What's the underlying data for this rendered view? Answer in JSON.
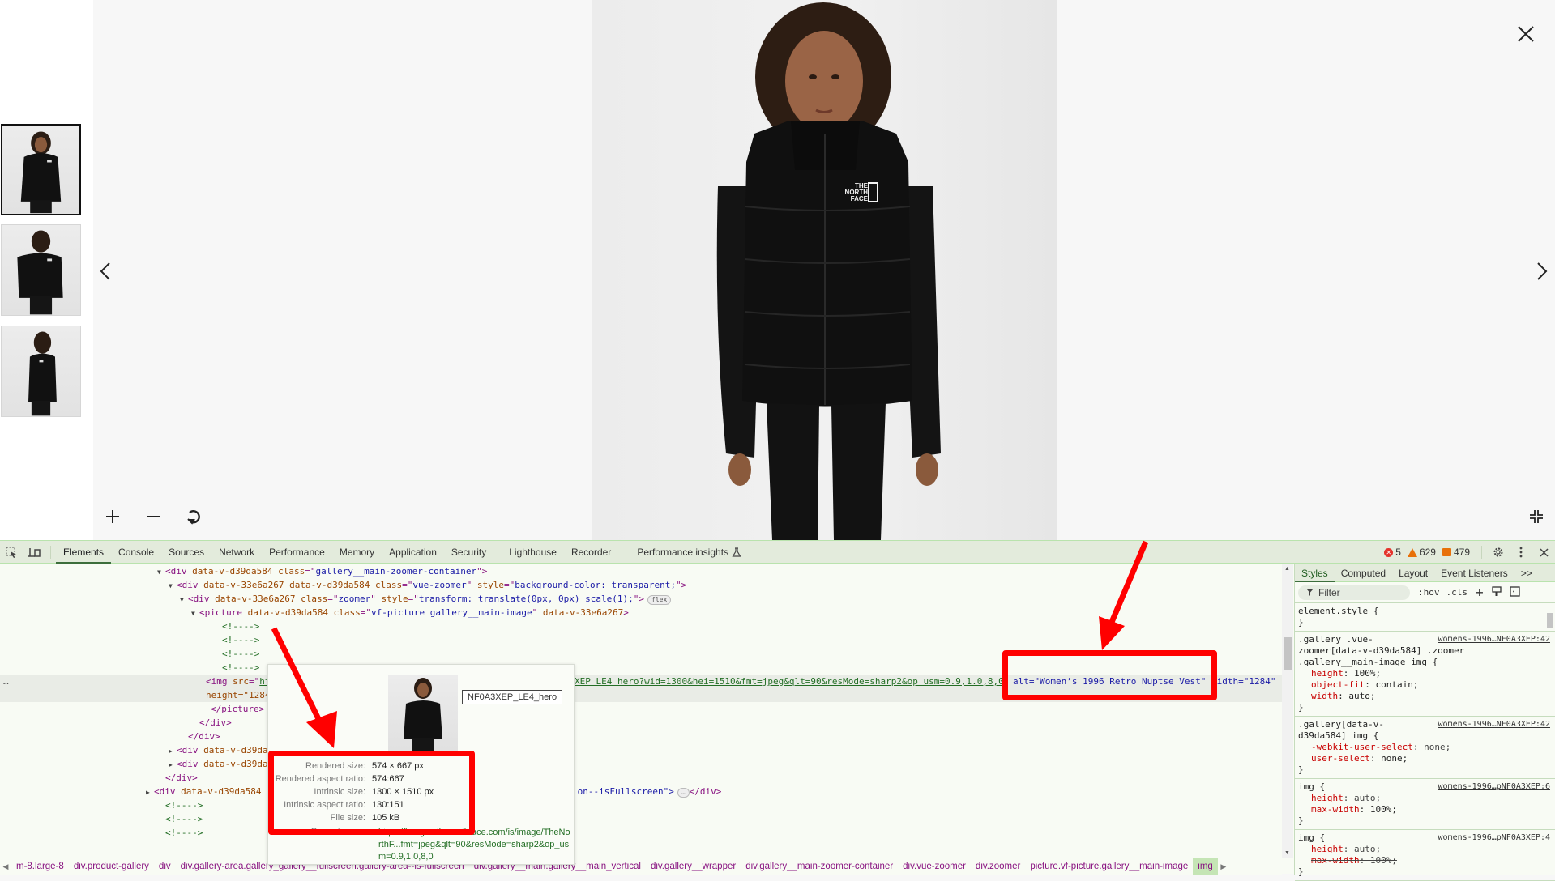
{
  "viewer": {
    "thumbnails": [
      {
        "label": "front view",
        "active": true
      },
      {
        "label": "back view",
        "active": false
      },
      {
        "label": "side view",
        "active": false
      }
    ],
    "main_image_alt": "Women's 1996 Retro Nuptse Vest",
    "brand_logo_text": [
      "THE",
      "NORTH",
      "FACE"
    ],
    "controls": {
      "zoom_in": "zoom-in",
      "zoom_out": "zoom-out",
      "reset": "reset-rotate",
      "prev": "previous-image",
      "next": "next-image",
      "close": "close",
      "exit_fullscreen": "exit-fullscreen"
    }
  },
  "devtools": {
    "tabs": [
      "Elements",
      "Console",
      "Sources",
      "Network",
      "Performance",
      "Memory",
      "Application",
      "Security",
      "Lighthouse",
      "Recorder",
      "Performance insights"
    ],
    "active_tab": "Elements",
    "counts": {
      "errors": "5",
      "warnings": "629",
      "issues": "479"
    },
    "code_lines": [
      {
        "indent": 11,
        "tri": "▼",
        "parts": [
          [
            "tag",
            "<div "
          ],
          [
            "attr",
            "data-v-d39da584 "
          ],
          [
            "attr",
            "class"
          ],
          [
            "tag",
            "=\""
          ],
          [
            "val",
            "gallery__main-zoomer-container"
          ],
          [
            "tag",
            "\">"
          ]
        ]
      },
      {
        "indent": 12,
        "tri": "▼",
        "parts": [
          [
            "tag",
            "<div "
          ],
          [
            "attr",
            "data-v-33e6a267 data-v-d39da584 "
          ],
          [
            "attr",
            "class"
          ],
          [
            "tag",
            "=\""
          ],
          [
            "val",
            "vue-zoomer"
          ],
          [
            "tag",
            "\" "
          ],
          [
            "attr",
            "style"
          ],
          [
            "tag",
            "=\""
          ],
          [
            "val",
            "background-color: transparent;"
          ],
          [
            "tag",
            "\">"
          ]
        ]
      },
      {
        "indent": 13,
        "tri": "▼",
        "parts": [
          [
            "tag",
            "<div "
          ],
          [
            "attr",
            "data-v-33e6a267 "
          ],
          [
            "attr",
            "class"
          ],
          [
            "tag",
            "=\""
          ],
          [
            "val",
            "zoomer"
          ],
          [
            "tag",
            "\" "
          ],
          [
            "attr",
            "style"
          ],
          [
            "tag",
            "=\""
          ],
          [
            "val",
            "transform: translate(0px, 0px) scale(1);"
          ],
          [
            "tag",
            "\">"
          ]
        ],
        "badge": "flex"
      },
      {
        "indent": 14,
        "tri": "▼",
        "parts": [
          [
            "tag",
            "<picture "
          ],
          [
            "attr",
            "data-v-d39da584 "
          ],
          [
            "attr",
            "class"
          ],
          [
            "tag",
            "=\""
          ],
          [
            "val",
            "vf-picture gallery__main-image"
          ],
          [
            "tag",
            "\" "
          ],
          [
            "attr",
            "data-v-33e6a267"
          ],
          [
            "tag",
            ">"
          ]
        ]
      },
      {
        "indent": 16,
        "tri": "",
        "parts": [
          [
            "cmt",
            "<!---->"
          ]
        ]
      },
      {
        "indent": 16,
        "tri": "",
        "parts": [
          [
            "cmt",
            "<!---->"
          ]
        ]
      },
      {
        "indent": 16,
        "tri": "",
        "parts": [
          [
            "cmt",
            "<!---->"
          ]
        ]
      },
      {
        "indent": 16,
        "tri": "",
        "parts": [
          [
            "cmt",
            "<!---->"
          ]
        ]
      }
    ],
    "selected_line": {
      "part1": "<img src=\"ht",
      "url_tail": "XEP LE4 hero?wid=1300&hei=1510&fmt=jpeg&qlt=90&resMode=sharp2&op usm=0.9,1.0,8,0",
      "alt_attr": "alt=\"Women’s 1996 Retro Nuptse Vest\"",
      "width_attr": "width=\"1284\"",
      "line2": "height=\"1284"
    },
    "code_lines_after": [
      {
        "indent": 15,
        "tri": "",
        "parts": [
          [
            "tag",
            "</picture>"
          ]
        ]
      },
      {
        "indent": 14,
        "tri": "",
        "parts": [
          [
            "tag",
            "</div>"
          ]
        ]
      },
      {
        "indent": 13,
        "tri": "",
        "parts": [
          [
            "tag",
            "</div>"
          ]
        ]
      },
      {
        "indent": 12,
        "tri": "▶",
        "parts": [
          [
            "tag",
            "<div "
          ],
          [
            "attr",
            "data-v-d39da58"
          ]
        ]
      },
      {
        "indent": 12,
        "tri": "▶",
        "parts": [
          [
            "tag",
            "<div "
          ],
          [
            "attr",
            "data-v-d39da58"
          ]
        ]
      },
      {
        "indent": 11,
        "tri": "",
        "parts": [
          [
            "tag",
            "</div>"
          ]
        ]
      },
      {
        "indent": 10,
        "tri": "▶",
        "parts": [
          [
            "tag",
            "<div "
          ],
          [
            "attr",
            "data-v-d39da584"
          ]
        ],
        "tail": "ion--isFullscreen\">"
      },
      {
        "indent": 11,
        "tri": "",
        "parts": [
          [
            "cmt",
            "<!---->"
          ]
        ]
      },
      {
        "indent": 11,
        "tri": "",
        "parts": [
          [
            "cmt",
            "<!---->"
          ]
        ]
      },
      {
        "indent": 11,
        "tri": "",
        "parts": [
          [
            "cmt",
            "<!---->"
          ]
        ]
      }
    ],
    "tooltip": {
      "image_name": "NF0A3XEP_LE4_hero",
      "rows": [
        {
          "k": "Rendered size:",
          "v": "574 × 667 px"
        },
        {
          "k": "Rendered aspect ratio:",
          "v": "574:667"
        },
        {
          "k": "Intrinsic size:",
          "v": "1300 × 1510 px"
        },
        {
          "k": "Intrinsic aspect ratio:",
          "v": "130:151"
        },
        {
          "k": "File size:",
          "v": "105 kB"
        }
      ],
      "current_source_label": "Current source:",
      "current_source": "https://images.thenorthface.com/is/image/TheNorthF...fmt=jpeg&qlt=90&resMode=sharp2&op_usm=0.9,1.0,8,0"
    },
    "breadcrumbs": [
      "m-8.large-8",
      "div.product-gallery",
      "div",
      "div.gallery-area.gallery_gallery__fullscreen.gallery-area--is-fullscreen",
      "div.gallery__main.gallery__main_vertical",
      "div.gallery__wrapper",
      "div.gallery__main-zoomer-container",
      "div.vue-zoomer",
      "div.zoomer",
      "picture.vf-picture.gallery__main-image",
      "img"
    ],
    "styles": {
      "tabs": [
        "Styles",
        "Computed",
        "Layout",
        "Event Listeners",
        ">>"
      ],
      "active_tab": "Styles",
      "filter_placeholder": "Filter",
      "hov": ":hov",
      "cls": ".cls",
      "rules": [
        {
          "selector": "element.style {",
          "source": "",
          "props": []
        },
        {
          "selector": ".gallery .vue-\nzoomer[data-v-d39da584] .zoomer\n.gallery__main-image img {",
          "source": "womens-1996…NF0A3XEP:42",
          "props": [
            {
              "name": "height",
              "value": "100%;",
              "strike": false
            },
            {
              "name": "object-fit",
              "value": "contain;",
              "strike": false
            },
            {
              "name": "width",
              "value": "auto;",
              "strike": false
            }
          ]
        },
        {
          "selector": ".gallery[data-v-\nd39da584] img {",
          "source": "womens-1996…NF0A3XEP:42",
          "props": [
            {
              "name": "-webkit-user-select",
              "value": "none;",
              "strike": true
            },
            {
              "name": "user-select",
              "value": "none;",
              "strike": false
            }
          ]
        },
        {
          "selector": "img {",
          "source": "womens-1996…pNF0A3XEP:6",
          "props": [
            {
              "name": "height",
              "value": "auto;",
              "strike": true
            },
            {
              "name": "max-width",
              "value": "100%;",
              "strike": false
            }
          ]
        },
        {
          "selector": "img {",
          "source": "womens-1996…pNF0A3XEP:4",
          "props": [
            {
              "name": "height",
              "value": "auto;",
              "strike": true
            },
            {
              "name": "max-width",
              "value": "100%;",
              "strike": true
            }
          ]
        }
      ]
    }
  },
  "colors": {
    "annotation": "#ff0000",
    "devtools_bg": "#f8fbf4",
    "toolbar_bg": "#e3ebdc",
    "error": "#e4322a",
    "warning": "#e8710a"
  }
}
